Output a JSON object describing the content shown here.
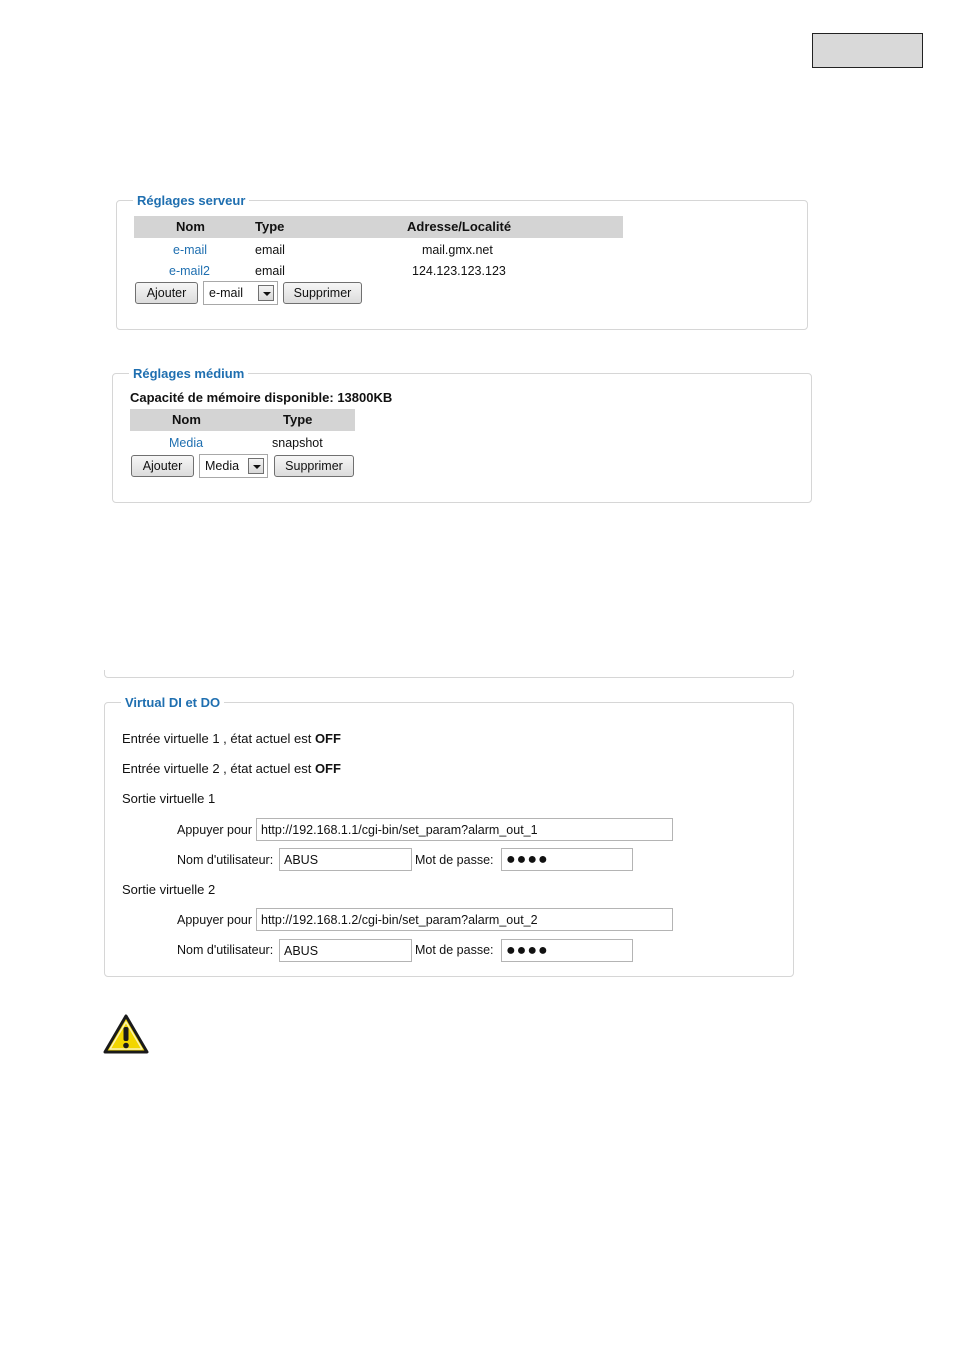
{
  "server_settings": {
    "legend": "Réglages serveur",
    "headers": [
      "Nom",
      "Type",
      "Adresse/Localité"
    ],
    "rows": [
      {
        "name": "e-mail",
        "type": "email",
        "address": "mail.gmx.net"
      },
      {
        "name": "e-mail2",
        "type": "email",
        "address": "124.123.123.123"
      }
    ],
    "add_label": "Ajouter",
    "select_value": "e-mail",
    "delete_label": "Supprimer"
  },
  "media_settings": {
    "legend": "Réglages médium",
    "capacity": "Capacité de mémoire disponible: 13800KB",
    "headers": [
      "Nom",
      "Type"
    ],
    "rows": [
      {
        "name": "Media",
        "type": "snapshot"
      }
    ],
    "add_label": "Ajouter",
    "select_value": "Media",
    "delete_label": "Supprimer"
  },
  "virtual_dido": {
    "legend": "Virtual DI et DO",
    "inputs": [
      {
        "prefix": "Entrée virtuelle 1 , état actuel est ",
        "state": "OFF"
      },
      {
        "prefix": "Entrée virtuelle 2 , état actuel est ",
        "state": "OFF"
      }
    ],
    "outputs": [
      {
        "title": "Sortie virtuelle 1",
        "press_label": "Appuyer pour",
        "url": "http://192.168.1.1/cgi-bin/set_param?alarm_out_1",
        "user_label": "Nom d'utilisateur:",
        "user": "ABUS",
        "pass_label": "Mot de passe:",
        "pass": "●●●●"
      },
      {
        "title": "Sortie virtuelle 2",
        "press_label": "Appuyer pour",
        "url": "http://192.168.1.2/cgi-bin/set_param?alarm_out_2",
        "user_label": "Nom d'utilisateur:",
        "user": "ABUS",
        "pass_label": "Mot de passe:",
        "pass": "●●●●"
      }
    ]
  },
  "icons": {
    "warning": "warning-triangle-icon",
    "dropdown": "chevron-down-icon"
  },
  "colors": {
    "accent": "#1f6fb0",
    "header_bg": "#d4d4d4",
    "warning_yellow": "#f2d600"
  }
}
